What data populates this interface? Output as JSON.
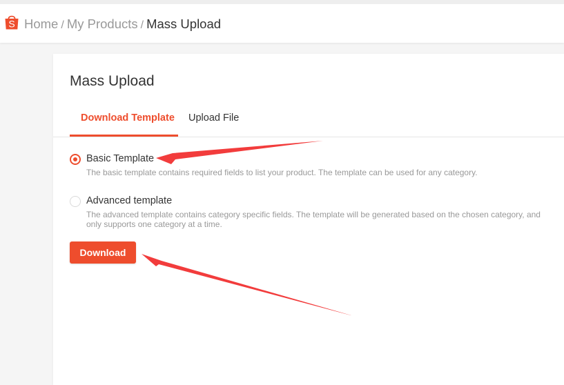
{
  "breadcrumb": {
    "home": "Home",
    "separator": "/",
    "my_products": "My Products",
    "current": "Mass Upload"
  },
  "card": {
    "title": "Mass Upload",
    "tabs": [
      {
        "label": "Download Template",
        "active": true
      },
      {
        "label": "Upload File",
        "active": false
      }
    ]
  },
  "options": [
    {
      "label": "Basic Template",
      "description": "The basic template contains required fields to list your product. The template can be used for any category.",
      "selected": true
    },
    {
      "label": "Advanced template",
      "description": "The advanced template contains category specific fields. The template will be generated based on the chosen category, and only supports one category at a time.",
      "selected": false
    }
  ],
  "download_button": {
    "label": "Download"
  },
  "colors": {
    "accent": "#ee4d2d",
    "arrow": "#f23c3c",
    "text": "#333333",
    "muted": "#999999"
  },
  "icons": {
    "logo": "shopee-bag-icon"
  }
}
